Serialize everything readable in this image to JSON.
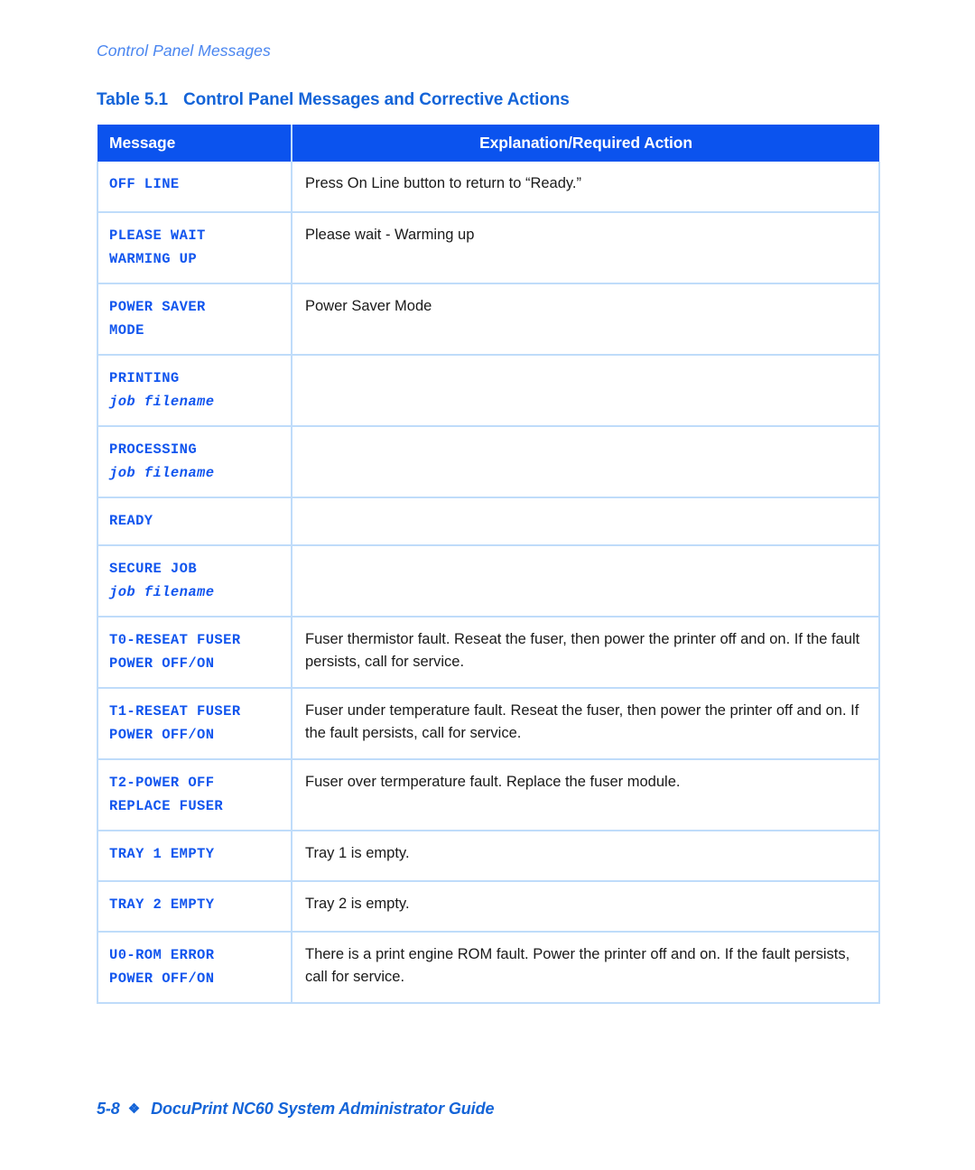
{
  "running_head": "Control Panel Messages",
  "table": {
    "caption_number": "Table 5.1",
    "caption_title": "Control Panel Messages and Corrective Actions",
    "header_bg": "#0b53ee",
    "border_color": "#bfdcfa",
    "message_color": "#1155ee",
    "columns": [
      {
        "label": "Message"
      },
      {
        "label": "Explanation/Required Action"
      }
    ],
    "rows": [
      {
        "message_lines": [
          {
            "text": "OFF LINE",
            "italic": false
          }
        ],
        "explanation": "Press On Line button to return to “Ready.”"
      },
      {
        "message_lines": [
          {
            "text": "PLEASE WAIT",
            "italic": false
          },
          {
            "text": "WARMING UP",
            "italic": false
          }
        ],
        "explanation": "Please wait - Warming up"
      },
      {
        "message_lines": [
          {
            "text": "POWER SAVER",
            "italic": false
          },
          {
            "text": "MODE",
            "italic": false
          }
        ],
        "explanation": "Power Saver Mode"
      },
      {
        "message_lines": [
          {
            "text": "PRINTING",
            "italic": false
          },
          {
            "text": "job filename",
            "italic": true
          }
        ],
        "explanation": ""
      },
      {
        "message_lines": [
          {
            "text": "PROCESSING",
            "italic": false
          },
          {
            "text": "job filename",
            "italic": true
          }
        ],
        "explanation": ""
      },
      {
        "message_lines": [
          {
            "text": "READY",
            "italic": false
          }
        ],
        "explanation": ""
      },
      {
        "message_lines": [
          {
            "text": "SECURE JOB",
            "italic": false
          },
          {
            "text": "job filename",
            "italic": true
          }
        ],
        "explanation": ""
      },
      {
        "message_lines": [
          {
            "text": "T0-RESEAT FUSER",
            "italic": false
          },
          {
            "text": "POWER OFF/ON",
            "italic": false
          }
        ],
        "explanation": "Fuser thermistor fault. Reseat the fuser, then power the printer off and on. If the fault persists, call for service."
      },
      {
        "message_lines": [
          {
            "text": "T1-RESEAT FUSER",
            "italic": false
          },
          {
            "text": "POWER OFF/ON",
            "italic": false
          }
        ],
        "explanation": "Fuser under temperature fault. Reseat the fuser, then power the printer off and on. If the fault persists, call for service."
      },
      {
        "message_lines": [
          {
            "text": "T2-POWER OFF",
            "italic": false
          },
          {
            "text": "REPLACE FUSER",
            "italic": false
          }
        ],
        "explanation": "Fuser over termperature fault. Replace the fuser module."
      },
      {
        "message_lines": [
          {
            "text": "TRAY 1 EMPTY",
            "italic": false
          }
        ],
        "explanation": "Tray 1 is empty."
      },
      {
        "message_lines": [
          {
            "text": "TRAY 2 EMPTY",
            "italic": false
          }
        ],
        "explanation": "Tray 2 is empty."
      },
      {
        "message_lines": [
          {
            "text": "U0-ROM ERROR",
            "italic": false
          },
          {
            "text": "POWER OFF/ON",
            "italic": false
          }
        ],
        "explanation": "There is a print engine ROM fault. Power the printer off and on. If the fault persists, call for service."
      }
    ]
  },
  "footer": {
    "page_number": "5-8",
    "separator": "❖",
    "guide_title": "DocuPrint NC60 System Administrator Guide"
  }
}
